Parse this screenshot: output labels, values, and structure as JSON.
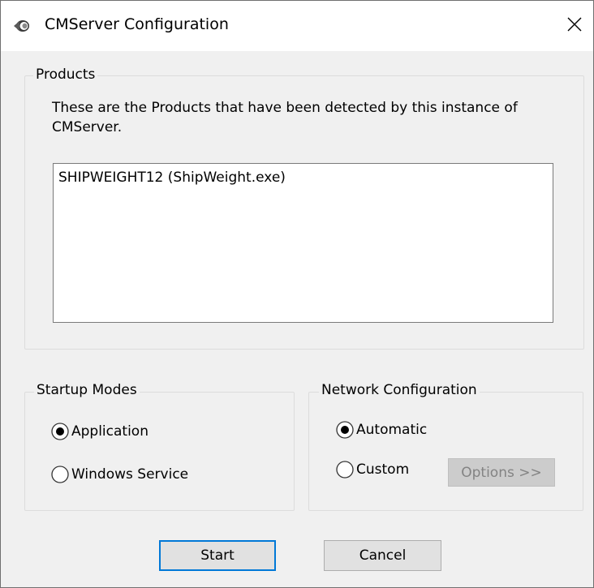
{
  "window": {
    "title": "CMServer Configuration",
    "close_glyph": "✕"
  },
  "products": {
    "group_label": "Products",
    "description": "These are the Products that have been detected by this instance of CMServer.",
    "items": [
      {
        "label": "SHIPWEIGHT12 (ShipWeight.exe)"
      }
    ]
  },
  "startup_modes": {
    "group_label": "Startup Modes",
    "options": [
      {
        "label": "Application",
        "selected": true
      },
      {
        "label": "Windows Service",
        "selected": false
      }
    ]
  },
  "network_configuration": {
    "group_label": "Network Configuration",
    "options": [
      {
        "label": "Automatic",
        "selected": true
      },
      {
        "label": "Custom",
        "selected": false
      }
    ],
    "options_button": {
      "label": "Options >>",
      "enabled": false
    }
  },
  "footer": {
    "start_label": "Start",
    "cancel_label": "Cancel"
  },
  "icons": {
    "app": "cmserver-app-icon",
    "close": "close-icon",
    "radio_selected": "radio-selected-icon",
    "radio_unselected": "radio-unselected-icon"
  },
  "colors": {
    "accent": "#0078d7",
    "window_bg": "#f0f0f0",
    "titlebar_bg": "#ffffff",
    "disabled_text": "#838383"
  }
}
